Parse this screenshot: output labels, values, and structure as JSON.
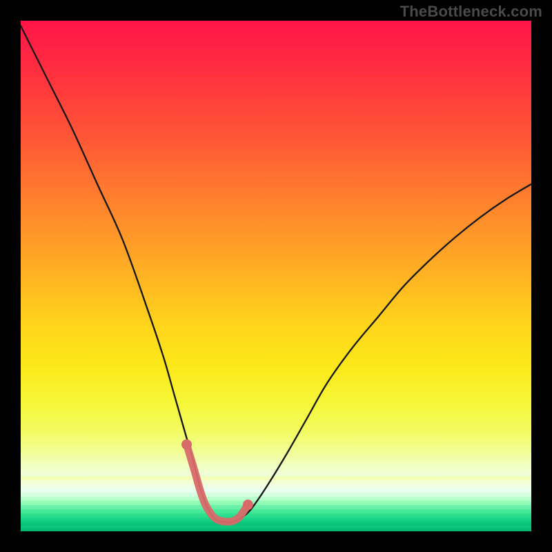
{
  "watermark": "TheBottleneck.com",
  "colors": {
    "background": "#000000",
    "watermark_text": "#4a4a4a",
    "curve_stroke": "#1a1a1a",
    "highlight_stroke": "#d86a6a",
    "highlight_dot": "#d86a6a"
  },
  "chart_data": {
    "type": "line",
    "title": "",
    "xlabel": "",
    "ylabel": "",
    "xlim": [
      0,
      100
    ],
    "ylim": [
      0,
      100
    ],
    "grid": false,
    "legend": false,
    "annotations": [
      "TheBottleneck.com"
    ],
    "series": [
      {
        "name": "bottleneck-curve",
        "x": [
          0,
          5,
          10,
          15,
          20,
          25,
          28,
          30,
          32,
          34,
          35,
          36,
          37,
          38,
          39,
          40,
          41,
          42,
          43,
          45,
          48,
          52,
          56,
          60,
          65,
          70,
          75,
          80,
          85,
          90,
          95,
          100
        ],
        "y": [
          99,
          89,
          79,
          68,
          57,
          43,
          34,
          27,
          20,
          13,
          9,
          6,
          3.8,
          2.5,
          2.0,
          1.8,
          1.8,
          2.0,
          2.5,
          4.2,
          8.5,
          15,
          22,
          29,
          36,
          42,
          48,
          53,
          57.5,
          61.5,
          65,
          68
        ]
      }
    ],
    "highlight": {
      "name": "fit-region",
      "x": [
        32.5,
        34,
        35,
        36,
        37,
        38,
        39,
        40,
        41,
        42,
        43,
        44.5
      ],
      "y": [
        17,
        12,
        8.5,
        5.6,
        3.8,
        2.6,
        2.1,
        1.9,
        1.9,
        2.2,
        3.0,
        5.2
      ]
    }
  }
}
